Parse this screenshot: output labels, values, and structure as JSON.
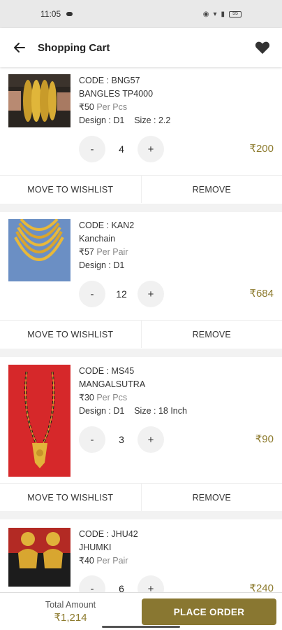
{
  "status_bar": {
    "time": "11:05",
    "battery": "55"
  },
  "header": {
    "title": "Shopping Cart"
  },
  "items": [
    {
      "code": "CODE : BNG57",
      "name": "BANGLES TP4000",
      "price": "₹50",
      "unit": "Per Pcs",
      "design": "Design : D1",
      "size": "Size : 2.2",
      "qty": "4",
      "total": "₹200"
    },
    {
      "code": "CODE : KAN2",
      "name": "Kanchain",
      "price": "₹57",
      "unit": "Per Pair",
      "design": "Design : D1",
      "size": "",
      "qty": "12",
      "total": "₹684"
    },
    {
      "code": "CODE : MS45",
      "name": "MANGALSUTRA",
      "price": "₹30",
      "unit": "Per Pcs",
      "design": "Design : D1",
      "size": "Size : 18 Inch",
      "qty": "3",
      "total": "₹90"
    },
    {
      "code": "CODE : JHU42",
      "name": "JHUMKI",
      "price": "₹40",
      "unit": "Per Pair",
      "design": "",
      "size": "",
      "qty": "6",
      "total": "₹240"
    }
  ],
  "actions": {
    "wishlist": "MOVE TO WISHLIST",
    "remove": "REMOVE",
    "minus": "-",
    "plus": "+"
  },
  "footer": {
    "total_label": "Total Amount",
    "total_amount": "₹1,214",
    "place_order": "PLACE ORDER"
  },
  "colors": {
    "accent": "#897731",
    "price": "#8d7b2e"
  }
}
